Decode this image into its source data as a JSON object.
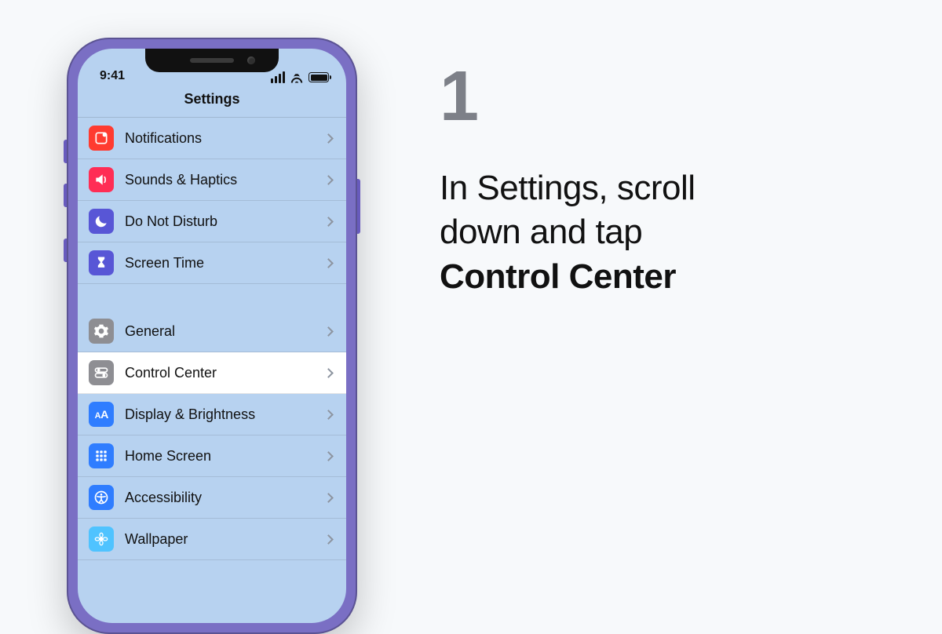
{
  "instruction": {
    "step_number": "1",
    "line1": "In Settings, scroll",
    "line2": "down and tap",
    "emphasis": "Control Center"
  },
  "status": {
    "time": "9:41"
  },
  "nav": {
    "title": "Settings"
  },
  "settings": {
    "group1": [
      {
        "id": "notifications",
        "label": "Notifications",
        "icon": "notifications-icon",
        "color": "ic-red"
      },
      {
        "id": "sounds-haptics",
        "label": "Sounds & Haptics",
        "icon": "sounds-icon",
        "color": "ic-pink"
      },
      {
        "id": "do-not-disturb",
        "label": "Do Not Disturb",
        "icon": "moon-icon",
        "color": "ic-purple"
      },
      {
        "id": "screen-time",
        "label": "Screen Time",
        "icon": "hourglass-icon",
        "color": "ic-purple"
      }
    ],
    "group2": [
      {
        "id": "general",
        "label": "General",
        "icon": "gear-icon",
        "color": "ic-gray",
        "selected": false
      },
      {
        "id": "control-center",
        "label": "Control Center",
        "icon": "switches-icon",
        "color": "ic-gray",
        "selected": true
      },
      {
        "id": "display-brightness",
        "label": "Display & Brightness",
        "icon": "text-size-icon",
        "color": "ic-blue",
        "selected": false
      },
      {
        "id": "home-screen",
        "label": "Home Screen",
        "icon": "grid-icon",
        "color": "ic-blue",
        "selected": false
      },
      {
        "id": "accessibility",
        "label": "Accessibility",
        "icon": "accessibility-icon",
        "color": "ic-blue",
        "selected": false
      },
      {
        "id": "wallpaper",
        "label": "Wallpaper",
        "icon": "flower-icon",
        "color": "ic-cyan",
        "selected": false
      }
    ]
  }
}
